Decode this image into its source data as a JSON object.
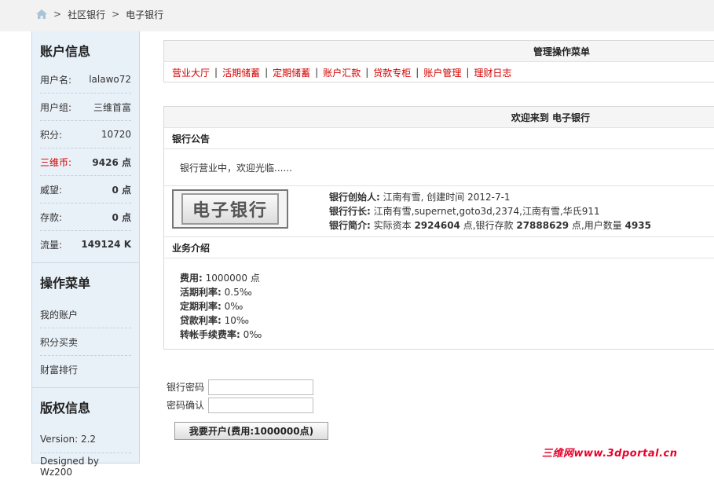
{
  "breadcrumb": [
    "社区银行",
    "电子银行"
  ],
  "sidebar": {
    "account_title": "账户信息",
    "rows": [
      {
        "label": "用户名:",
        "value": "lalawo72"
      },
      {
        "label": "用户组:",
        "value": "三维首富"
      },
      {
        "label": "积分:",
        "value": "10720"
      },
      {
        "label": "三维币:",
        "value": "9426 点"
      },
      {
        "label": "威望:",
        "value": "0 点"
      },
      {
        "label": "存款:",
        "value": "0 点"
      },
      {
        "label": "流量:",
        "value": "149124 K"
      }
    ],
    "ops_title": "操作菜单",
    "ops_items": [
      "我的账户",
      "积分买卖",
      "财富排行"
    ],
    "copyright_title": "版权信息",
    "copyright_items": [
      "Version: 2.2",
      "Designed by Wz200"
    ]
  },
  "menu_panel": {
    "title": "管理操作菜单",
    "links": [
      "营业大厅",
      "活期储蓄",
      "定期储蓄",
      "账户汇款",
      "贷款专柜",
      "账户管理",
      "理财日志"
    ]
  },
  "welcome": {
    "title": "欢迎来到 电子银行",
    "notice_title": "银行公告",
    "notice_text": "银行营业中，欢迎光临......",
    "logo_text": "电子银行",
    "founder_label": "银行创始人:",
    "founder_value": " 江南有雪, 创建时间 2012-7-1",
    "president_label": "银行行长:",
    "president_value": " 江南有雪,supernet,goto3d,2374,江南有雪,华氏911",
    "intro_label": "银行简介:",
    "intro_a": " 实际资本 ",
    "capital": "2924604",
    "intro_b": " 点,银行存款 ",
    "deposits": "27888629",
    "intro_c": " 点,用户数量 ",
    "users": "4935",
    "biz_title": "业务介绍",
    "biz": [
      {
        "label": "费用:",
        "value": " 1000000 点"
      },
      {
        "label": "活期利率:",
        "value": " 0.5‰"
      },
      {
        "label": "定期利率:",
        "value": " 0‰"
      },
      {
        "label": "贷款利率:",
        "value": " 10‰"
      },
      {
        "label": "转帐手续费率:",
        "value": " 0‰"
      }
    ]
  },
  "form": {
    "password_label": "银行密码",
    "confirm_label": "密码确认",
    "submit_label": "我要开户(费用:1000000点)"
  },
  "watermark": "三维网www.3dportal.cn"
}
